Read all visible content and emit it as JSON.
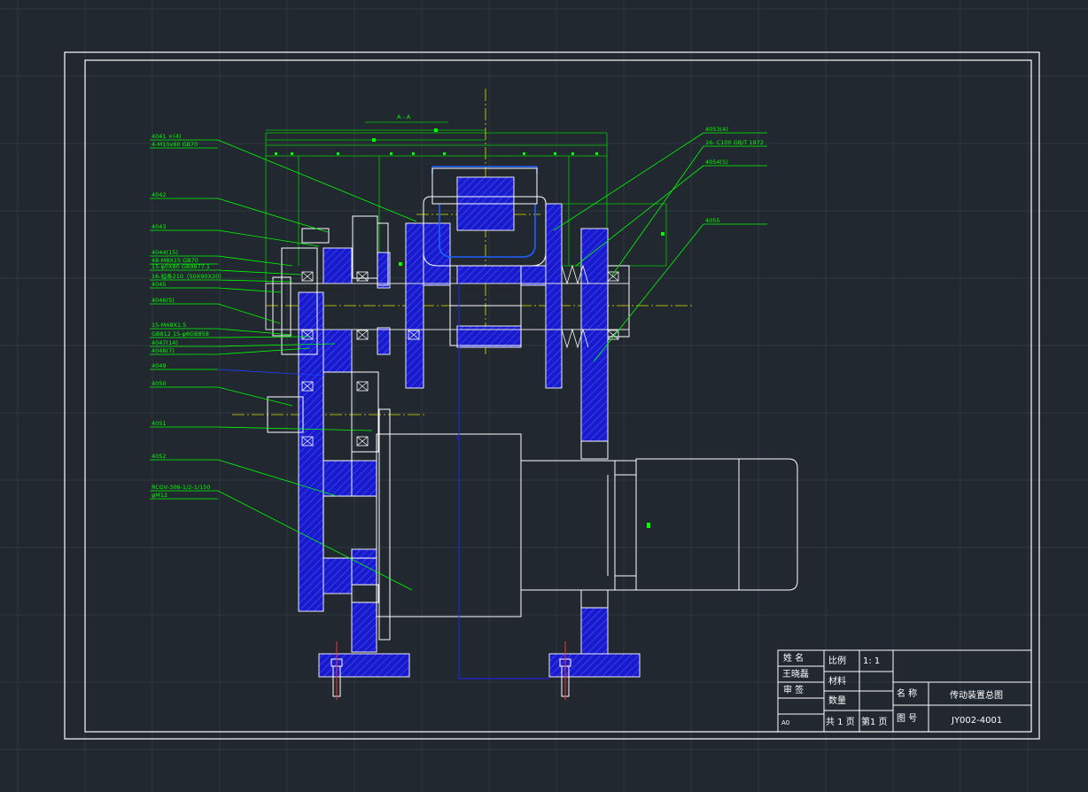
{
  "drawing": {
    "section_label": "A - A",
    "colors": {
      "background": "#212830",
      "grid": "#2e3640",
      "frame": "#ffffff",
      "leader": "#00ff00",
      "centerline": "#e0e000",
      "hatch": "#1a1acc",
      "outline": "#ffffff",
      "dim": "#00cc00",
      "red": "#ff3030"
    },
    "callouts_left": [
      {
        "line1": "4041    ×(4)",
        "line2": "4-M10x60 GB70"
      },
      {
        "line1": "4042",
        "line2": ""
      },
      {
        "line1": "4043",
        "line2": ""
      },
      {
        "line1": "4044(15)",
        "line2": "48-M8X15 GB70"
      },
      {
        "line1": "15-φ0X80 GB9877.1",
        "line2": ""
      },
      {
        "line1": "16-毡条210（50X90X20）",
        "line2": ""
      },
      {
        "line1": "4045",
        "line2": ""
      },
      {
        "line1": "4046(5)",
        "line2": ""
      },
      {
        "line1": "15-M48X1.5",
        "line2": ""
      },
      {
        "line1": "GB812 15-φ8GB858",
        "line2": ""
      },
      {
        "line1": "4047(14)",
        "line2": ""
      },
      {
        "line1": "4048(7)",
        "line2": ""
      },
      {
        "line1": "4049",
        "line2": ""
      },
      {
        "line1": "4050",
        "line2": ""
      },
      {
        "line1": "4051",
        "line2": ""
      },
      {
        "line1": "4052",
        "line2": ""
      },
      {
        "line1": "RCGV-306-1/2-1/150",
        "line2": "φM12"
      }
    ],
    "callouts_right": [
      {
        "line1": "4053(4)",
        "line2": "16- C100 GB/T 1972"
      },
      {
        "line1": "4054(5)",
        "line2": ""
      },
      {
        "line1": "4055",
        "line2": ""
      }
    ]
  },
  "title_block": {
    "name_label": "姓  名",
    "name_value": "王晓磊",
    "review_label": "审  签",
    "sheet_size": "A0",
    "scale_label": "比例",
    "scale_value": "1: 1",
    "material_label": "材料",
    "quantity_label": "数量",
    "total_pages": "共 1 页",
    "page_no": "第1 页",
    "title_label": "名  称",
    "title_value": "传动装置总图",
    "drawing_no_label": "图  号",
    "drawing_no_value": "JY002-4001"
  }
}
